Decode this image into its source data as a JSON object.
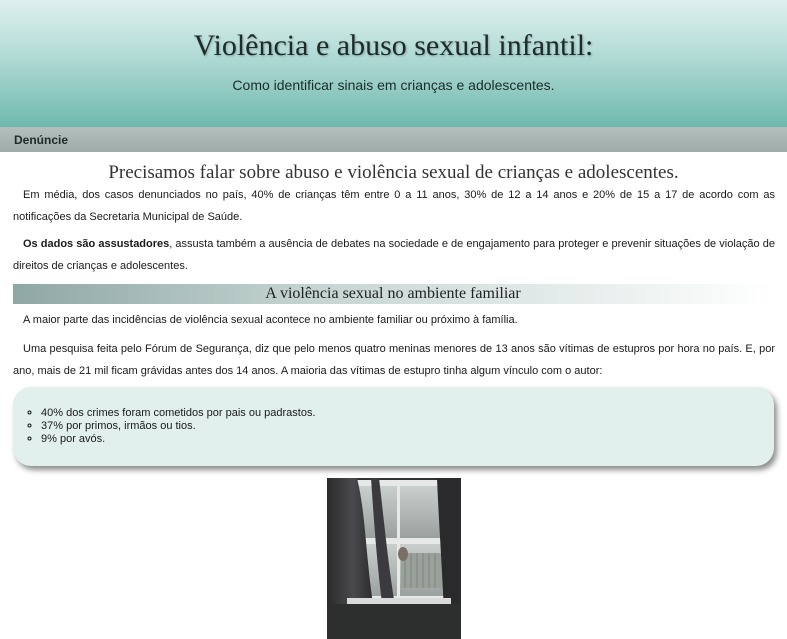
{
  "header": {
    "title": "Violência e abuso sexual infantil:",
    "subtitle": "Como identificar sinais em crianças e adolescentes."
  },
  "nav": {
    "items": [
      "Denúncie"
    ]
  },
  "main": {
    "heading": "Precisamos falar sobre abuso e violência sexual de crianças e adolescentes.",
    "p1": "Em média, dos casos denunciados no país, 40% de crianças têm entre 0 a 11 anos, 30% de 12 a 14 anos e 20% de 15 a 17 de acordo com as notificações da Secretaria Municipal de Saúde.",
    "p2_bold": "Os dados são assustadores",
    "p2_rest": ", assusta também a ausência de debates na sociedade e de engajamento para proteger e prevenir situações de violação de direitos de crianças e adolescentes.",
    "section_title": "A violência sexual no ambiente familiar",
    "p3": "A maior parte das incidências de violência sexual acontece no ambiente familiar ou próximo à família.",
    "p4": "Uma pesquisa feita pelo Fórum de Segurança, diz que pelo menos quatro meninas menores de 13 anos são vítimas de estupros por hora no país. E, por ano, mais de 21 mil ficam grávidas antes dos 14 anos. A maioria das vítimas de estupro tinha algum vínculo com o autor:",
    "list": [
      "40% dos crimes foram cometidos por pais ou padrastos.",
      "37% por primos, irmãos ou tios.",
      "9% por avós."
    ]
  },
  "colors": {
    "header_top": "#dff0ee",
    "header_bottom": "#6fb9ae",
    "nav_bg": "#9dacaa",
    "infobox_bg": "#e1efed"
  }
}
